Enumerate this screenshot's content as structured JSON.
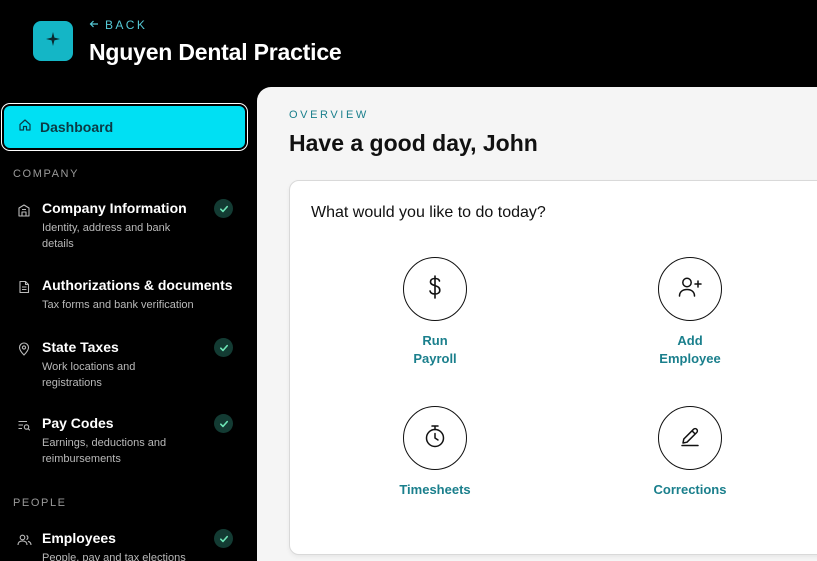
{
  "header": {
    "back_label": "BACK",
    "title": "Nguyen Dental Practice",
    "logo_icon": "sparkle-icon",
    "accent": "#14b6c6"
  },
  "sidebar": {
    "active": {
      "label": "Dashboard",
      "icon": "home-icon",
      "color": "#00e0f3"
    },
    "sections": [
      {
        "label": "COMPANY",
        "items": [
          {
            "title": "Company Information",
            "description": "Identity, address and bank details",
            "icon": "building-icon",
            "complete": true
          },
          {
            "title": "Authorizations & documents",
            "description": "Tax forms and bank verification",
            "icon": "document-icon",
            "complete": false
          },
          {
            "title": "State Taxes",
            "description": "Work locations and registrations",
            "icon": "location-pin-icon",
            "complete": true
          },
          {
            "title": "Pay Codes",
            "description": "Earnings, deductions and reimbursements",
            "icon": "list-search-icon",
            "complete": true
          }
        ]
      },
      {
        "label": "PEOPLE",
        "items": [
          {
            "title": "Employees",
            "description": "People, pay and tax elections",
            "icon": "users-icon",
            "complete": true
          }
        ]
      }
    ]
  },
  "main": {
    "overline": "OVERVIEW",
    "greeting": "Have a good day, John",
    "card": {
      "title": "What would you like to do today?",
      "actions": [
        {
          "label_line1": "Run",
          "label_line2": "Payroll",
          "icon": "dollar-icon"
        },
        {
          "label_line1": "Add",
          "label_line2": "Employee",
          "icon": "add-user-icon"
        },
        {
          "label_line1": "Timesheets",
          "label_line2": "",
          "icon": "stopwatch-icon"
        },
        {
          "label_line1": "Corrections",
          "label_line2": "",
          "icon": "pencil-icon"
        }
      ]
    }
  }
}
